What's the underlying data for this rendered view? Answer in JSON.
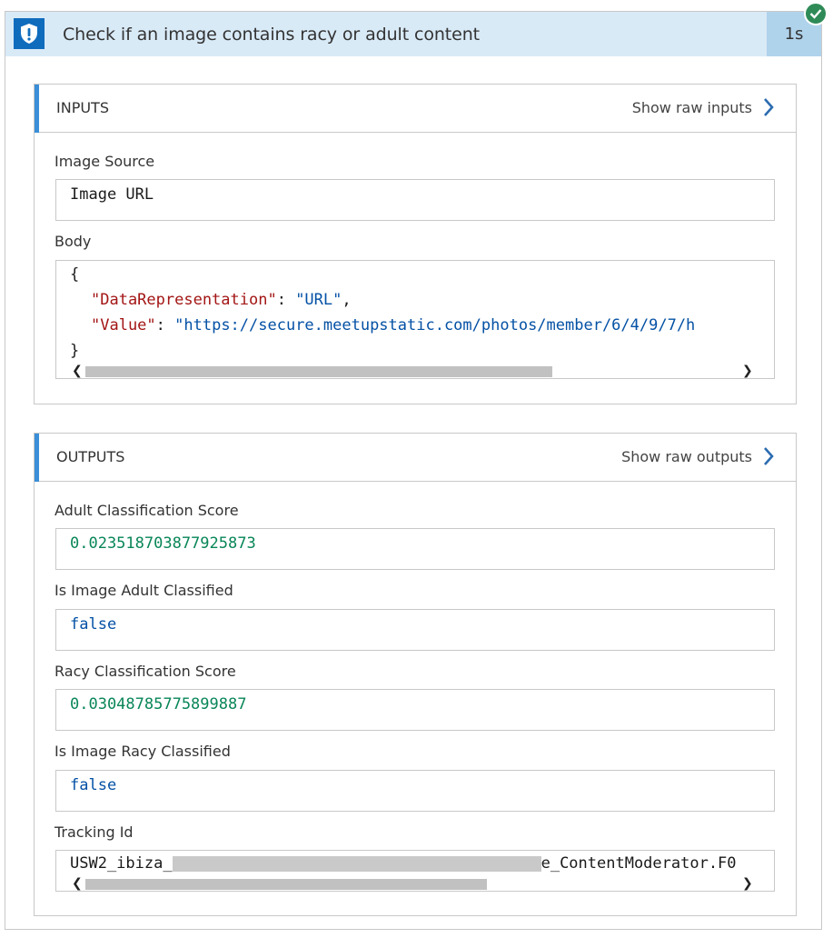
{
  "header": {
    "title": "Check if an image contains racy or adult content",
    "duration": "1s",
    "status_icon": "check-icon",
    "action_icon": "shield-exclamation-icon"
  },
  "inputs": {
    "title": "INPUTS",
    "raw_link": "Show raw inputs",
    "image_source": {
      "label": "Image Source",
      "value": "Image URL"
    },
    "body": {
      "label": "Body",
      "open": "{",
      "key1": "\"DataRepresentation\"",
      "val1": "\"URL\"",
      "key2": "\"Value\"",
      "val2": "\"https://secure.meetupstatic.com/photos/member/6/4/9/7/h",
      "close": "}"
    }
  },
  "outputs": {
    "title": "OUTPUTS",
    "raw_link": "Show raw outputs",
    "fields": [
      {
        "label": "Adult Classification Score",
        "value": "0.023518703877925873"
      },
      {
        "label": "Is Image Adult Classified",
        "value": "false"
      },
      {
        "label": "Racy Classification Score",
        "value": "0.03048785775899887"
      },
      {
        "label": "Is Image Racy Classified",
        "value": "false"
      }
    ],
    "tracking": {
      "label": "Tracking Id",
      "prefix": "USW2_ibiza_",
      "suffix": "e_ContentModerator.F0"
    }
  },
  "colors": {
    "header_bg": "#d9eaf7",
    "accent": "#0f6cbd",
    "success": "#2e8b57",
    "number": "#098658",
    "string": "#0451a5",
    "key": "#a31515"
  }
}
